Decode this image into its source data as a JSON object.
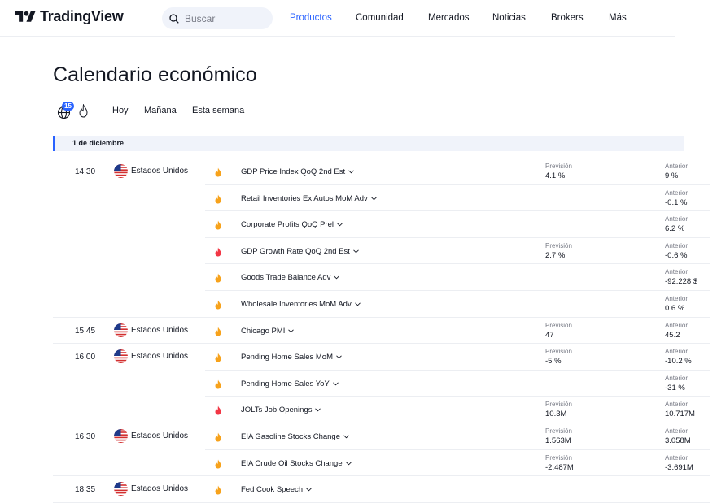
{
  "header": {
    "logo_text": "TradingView",
    "search_placeholder": "Buscar",
    "nav": [
      "Productos",
      "Comunidad",
      "Mercados",
      "Noticias",
      "Brokers",
      "Más"
    ],
    "active_nav": "Productos",
    "accent_color": "#2962ff"
  },
  "page": {
    "title": "Calendario económico"
  },
  "filters": {
    "country_count": "15",
    "tabs": [
      "Hoy",
      "Mañana",
      "Esta semana"
    ]
  },
  "date_label": "1 de diciembre",
  "labels": {
    "forecast": "Previsión",
    "previous": "Anterior"
  },
  "colors": {
    "importance_medium": "#f7a21b",
    "importance_high": "#f23645"
  },
  "events": [
    {
      "time": "14:30",
      "country": "Estados Unidos",
      "importance": "medium",
      "name": "GDP Price Index QoQ 2nd Est",
      "forecast": "4.1 %",
      "previous": "9 %"
    },
    {
      "time": "",
      "country": "",
      "importance": "medium",
      "name": "Retail Inventories Ex Autos MoM Adv",
      "forecast": "",
      "previous": "-0.1 %"
    },
    {
      "time": "",
      "country": "",
      "importance": "medium",
      "name": "Corporate Profits QoQ Prel",
      "forecast": "",
      "previous": "6.2 %"
    },
    {
      "time": "",
      "country": "",
      "importance": "high",
      "name": "GDP Growth Rate QoQ 2nd Est",
      "forecast": "2.7 %",
      "previous": "-0.6 %"
    },
    {
      "time": "",
      "country": "",
      "importance": "medium",
      "name": "Goods Trade Balance Adv",
      "forecast": "",
      "previous": "-92.228 $"
    },
    {
      "time": "",
      "country": "",
      "importance": "medium",
      "name": "Wholesale Inventories MoM Adv",
      "forecast": "",
      "previous": "0.6 %"
    },
    {
      "time": "15:45",
      "country": "Estados Unidos",
      "importance": "medium",
      "name": "Chicago PMI",
      "forecast": "47",
      "previous": "45.2"
    },
    {
      "time": "16:00",
      "country": "Estados Unidos",
      "importance": "medium",
      "name": "Pending Home Sales MoM",
      "forecast": "-5 %",
      "previous": "-10.2 %"
    },
    {
      "time": "",
      "country": "",
      "importance": "medium",
      "name": "Pending Home Sales YoY",
      "forecast": "",
      "previous": "-31 %"
    },
    {
      "time": "",
      "country": "",
      "importance": "high",
      "name": "JOLTs Job Openings",
      "forecast": "10.3M",
      "previous": "10.717M"
    },
    {
      "time": "16:30",
      "country": "Estados Unidos",
      "importance": "medium",
      "name": "EIA Gasoline Stocks Change",
      "forecast": "1.563M",
      "previous": "3.058M"
    },
    {
      "time": "",
      "country": "",
      "importance": "medium",
      "name": "EIA Crude Oil Stocks Change",
      "forecast": "-2.487M",
      "previous": "-3.691M"
    },
    {
      "time": "18:35",
      "country": "Estados Unidos",
      "importance": "medium",
      "name": "Fed Cook Speech",
      "forecast": "",
      "previous": ""
    }
  ]
}
